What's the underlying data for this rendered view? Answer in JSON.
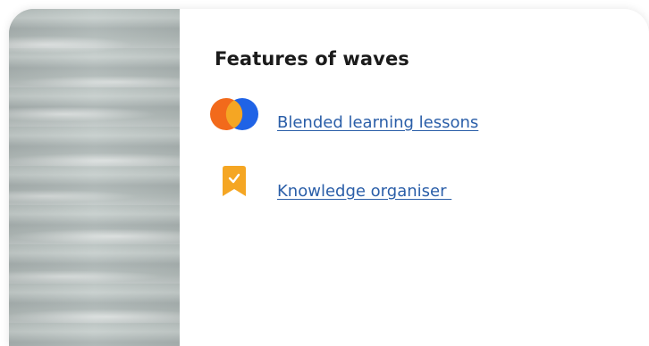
{
  "card": {
    "title": "Features of waves",
    "resources": [
      {
        "label": "Blended learning lessons",
        "icon": "blended-learning-icon"
      },
      {
        "label": "Knowledge organiser ",
        "icon": "bookmark-check-icon"
      }
    ]
  },
  "colors": {
    "link": "#2a5ea8",
    "orange": "#f26a1b",
    "blue": "#1f63e6",
    "amber": "#f5a623"
  }
}
